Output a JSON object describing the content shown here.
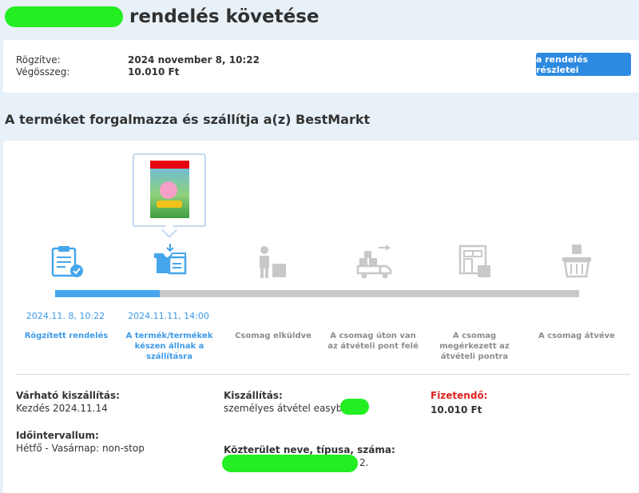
{
  "header": {
    "title_suffix": "rendelés követése"
  },
  "order": {
    "recorded_label": "Rögzítve:",
    "recorded_value": "2024 november 8, 10:22",
    "total_label": "Végösszeg:",
    "total_value": "10.010 Ft",
    "details_button": "a rendelés részletei"
  },
  "seller_heading": "A terméket forgalmazza és szállítja a(z) BestMarkt",
  "steps": [
    {
      "date": "2024.11. 8, 10:22",
      "label": "Rögzített rendelés",
      "icon": "clipboard-check-icon",
      "done": true
    },
    {
      "date": "2024.11.11, 14:00",
      "label": "A termék/termékek készen állnak a szállításra",
      "icon": "open-box-icon",
      "done": true
    },
    {
      "date": "",
      "label": "Csomag elküldve",
      "icon": "courier-package-icon",
      "done": false
    },
    {
      "date": "",
      "label": "A csomag úton van az átvételi pont felé",
      "icon": "delivery-truck-icon",
      "done": false
    },
    {
      "date": "",
      "label": "A csomag megérkezett az átvételi pontra",
      "icon": "pickup-point-icon",
      "done": false
    },
    {
      "date": "",
      "label": "A csomag átvéve",
      "icon": "basket-icon",
      "done": false
    }
  ],
  "progress_fraction": 0.2,
  "colors": {
    "accent": "#45a6ec",
    "button": "#2d8ae0",
    "inactive": "#c8c8c8",
    "due": "#e02020",
    "redaction": "#22ee22"
  },
  "info": {
    "expected_label": "Várható kiszállítás:",
    "expected_value": "Kezdés 2024.11.14",
    "interval_label": "Időintervallum:",
    "interval_value": "Hétfő - Vasárnap: non-stop",
    "shipping_label": "Kiszállítás:",
    "shipping_value": "személyes átvétel easybo",
    "address_label": "Közterület neve, típusa, száma:",
    "address_tail": "2.",
    "due_label": "Fizetendő:",
    "due_value": "10.010 Ft"
  }
}
